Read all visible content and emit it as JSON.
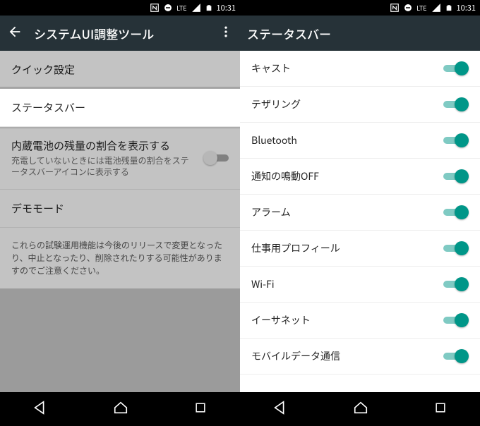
{
  "status_bar": {
    "network_label": "LTE",
    "time": "10:31"
  },
  "left": {
    "app_title": "システムUI調整ツール",
    "items": {
      "quick_settings": "クイック設定",
      "status_bar": "ステータスバー",
      "battery_pct_title": "内蔵電池の残量の割合を表示する",
      "battery_pct_desc": "充電していないときには電池残量の割合をステータスバーアイコンに表示する",
      "demo_mode": "デモモード"
    },
    "footer": "これらの試験運用機能は今後のリリースで変更となったり、中止となったり、削除されたりする可能性がありますのでご注意ください。"
  },
  "right": {
    "app_title": "ステータスバー",
    "items": [
      {
        "label": "キャスト",
        "on": true
      },
      {
        "label": "テザリング",
        "on": true
      },
      {
        "label": "Bluetooth",
        "on": true
      },
      {
        "label": "通知の鳴動OFF",
        "on": true
      },
      {
        "label": "アラーム",
        "on": true
      },
      {
        "label": "仕事用プロフィール",
        "on": true
      },
      {
        "label": "Wi-Fi",
        "on": true
      },
      {
        "label": "イーサネット",
        "on": true
      },
      {
        "label": "モバイルデータ通信",
        "on": true
      }
    ]
  }
}
